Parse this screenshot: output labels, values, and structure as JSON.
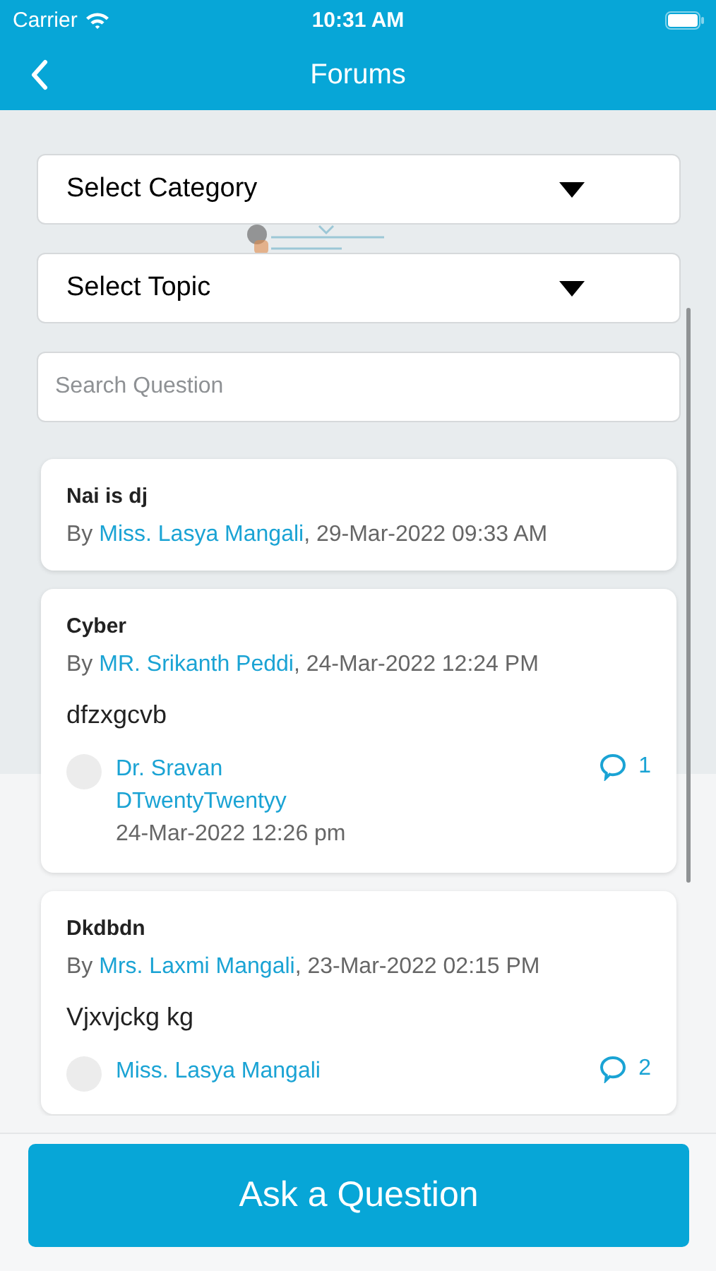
{
  "status_bar": {
    "carrier": "Carrier",
    "time": "10:31 AM"
  },
  "nav": {
    "title": "Forums"
  },
  "filters": [
    {
      "label": "Select Category"
    },
    {
      "label": "Select Topic"
    }
  ],
  "search": {
    "placeholder": "Search Question"
  },
  "posts": [
    {
      "title": "Nai is dj",
      "by": "By",
      "author": "Miss. Lasya Mangali",
      "date": ", 29-Mar-2022 09:33 AM"
    },
    {
      "title": "Cyber",
      "by": "By",
      "author": "MR. Srikanth Peddi",
      "date": ", 24-Mar-2022 12:24 PM",
      "body": "dfzxgcvb",
      "reply": {
        "name": "Dr. Sravan DTwentyTwentyy",
        "date": "24-Mar-2022 12:26 pm",
        "count": "1"
      }
    },
    {
      "title": "Dkdbdn",
      "by": "By",
      "author": "Mrs. Laxmi Mangali",
      "date": ", 23-Mar-2022 02:15 PM",
      "body": "Vjxvjckg kg",
      "reply": {
        "name": "Miss. Lasya Mangali",
        "count": "2"
      }
    }
  ],
  "ask_button": {
    "label": "Ask a Question"
  }
}
